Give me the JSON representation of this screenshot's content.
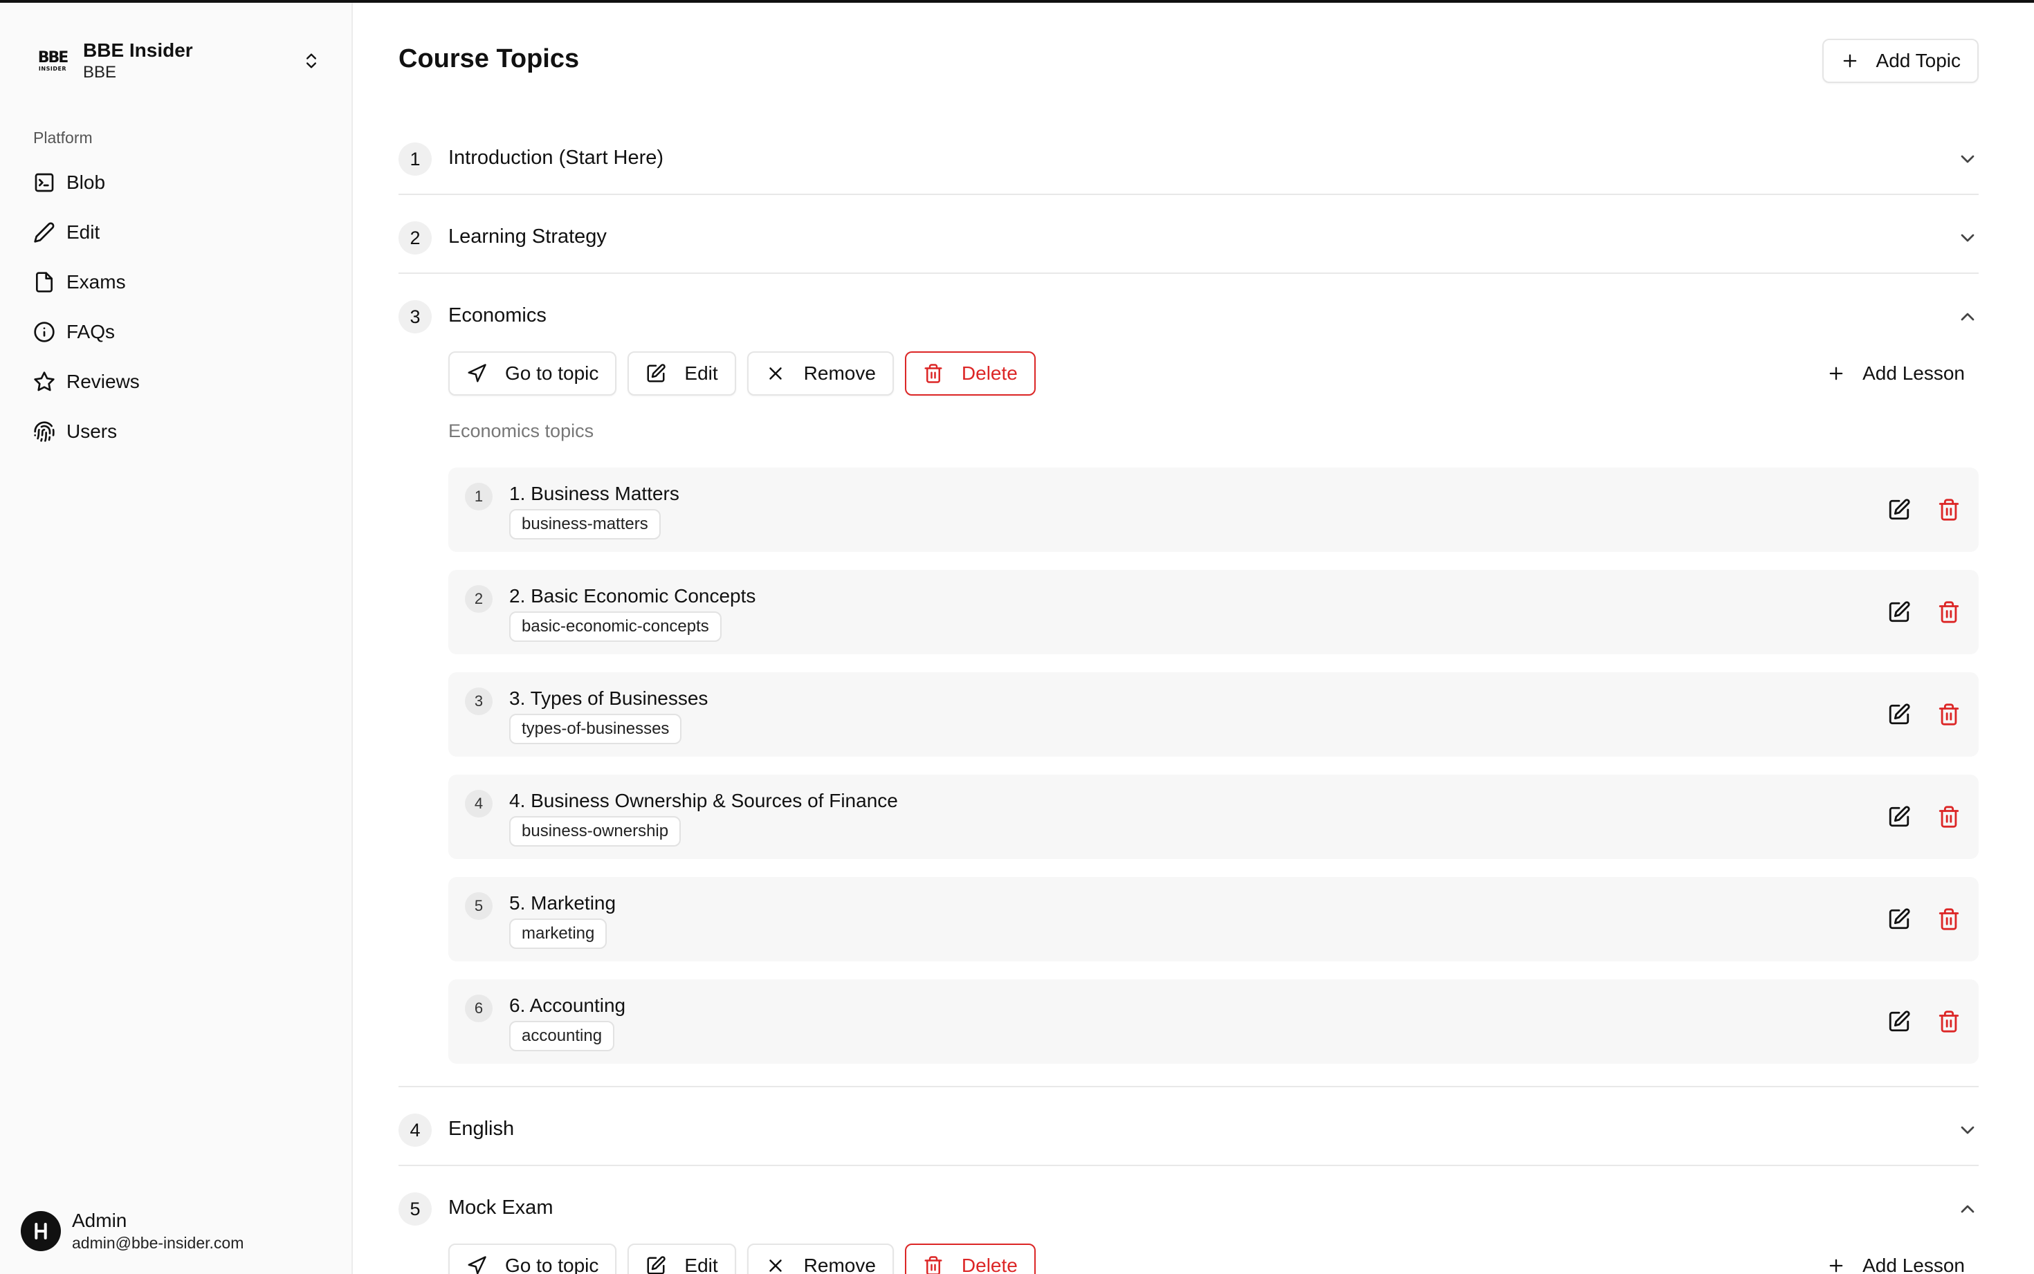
{
  "brand": {
    "logo_top": "BBE",
    "logo_bottom": "INSIDER",
    "name": "BBE Insider",
    "sub": "BBE"
  },
  "sidebar": {
    "group_label": "Platform",
    "items": [
      {
        "label": "Blob",
        "icon": "terminal-icon"
      },
      {
        "label": "Edit",
        "icon": "pencil-icon"
      },
      {
        "label": "Exams",
        "icon": "file-icon"
      },
      {
        "label": "FAQs",
        "icon": "info-icon"
      },
      {
        "label": "Reviews",
        "icon": "star-icon"
      },
      {
        "label": "Users",
        "icon": "fingerprint-icon"
      }
    ]
  },
  "user": {
    "name": "Admin",
    "email": "admin@bbe-insider.com"
  },
  "main": {
    "title": "Course Topics",
    "add_topic_label": "Add Topic",
    "action_labels": {
      "go": "Go to topic",
      "edit": "Edit",
      "remove": "Remove",
      "delete": "Delete",
      "add_lesson": "Add Lesson"
    },
    "topics": [
      {
        "num": "1",
        "title": "Introduction (Start Here)"
      },
      {
        "num": "2",
        "title": "Learning Strategy"
      },
      {
        "num": "3",
        "title": "Economics",
        "sub_label": "Economics topics",
        "lessons": [
          {
            "num": "1",
            "title": "1. Business Matters",
            "slug": "business-matters"
          },
          {
            "num": "2",
            "title": "2. Basic Economic Concepts",
            "slug": "basic-economic-concepts"
          },
          {
            "num": "3",
            "title": "3. Types of Businesses",
            "slug": "types-of-businesses"
          },
          {
            "num": "4",
            "title": "4. Business Ownership & Sources of Finance",
            "slug": "business-ownership"
          },
          {
            "num": "5",
            "title": "5. Marketing",
            "slug": "marketing"
          },
          {
            "num": "6",
            "title": "6. Accounting",
            "slug": "accounting"
          }
        ]
      },
      {
        "num": "4",
        "title": "English"
      },
      {
        "num": "5",
        "title": "Mock Exam"
      }
    ]
  },
  "colors": {
    "danger": "#dc2626",
    "border": "#e5e5e5",
    "sidebar_bg": "#fafafa"
  }
}
